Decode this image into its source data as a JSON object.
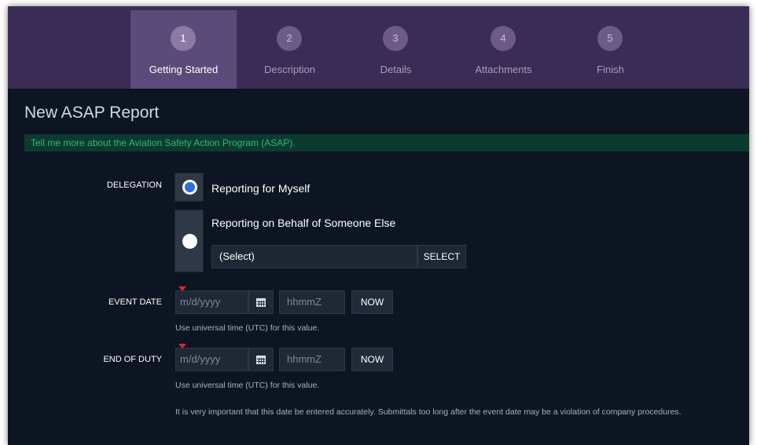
{
  "wizard": {
    "steps": [
      {
        "number": "1",
        "label": "Getting Started"
      },
      {
        "number": "2",
        "label": "Description"
      },
      {
        "number": "3",
        "label": "Details"
      },
      {
        "number": "4",
        "label": "Attachments"
      },
      {
        "number": "5",
        "label": "Finish"
      }
    ],
    "active_step": 1
  },
  "page": {
    "title": "New ASAP Report",
    "info_link": "Tell me more about the Aviation Safety Action Program (ASAP)."
  },
  "delegation": {
    "label": "DELEGATION",
    "option_self": "Reporting for Myself",
    "option_other": "Reporting on Behalf of Someone Else",
    "selected": "self",
    "select_value": "(Select)",
    "select_button": "SELECT"
  },
  "event_date": {
    "label": "EVENT DATE",
    "date_placeholder": "m/d/yyyy",
    "time_placeholder": "hhmmZ",
    "now_button": "NOW",
    "help": "Use universal time (UTC) for this value."
  },
  "end_of_duty": {
    "label": "END OF DUTY",
    "date_placeholder": "m/d/yyyy",
    "time_placeholder": "hhmmZ",
    "now_button": "NOW",
    "help": "Use universal time (UTC) for this value.",
    "warning": "It is very important that this date be entered accurately. Submittals too long after the event date may be a violation of company procedures."
  },
  "icons": {
    "calendar": "calendar-icon",
    "required": "required-marker"
  },
  "colors": {
    "header_bg": "#3a2d55",
    "active_step_bg": "#5b4b78",
    "page_bg": "#0c1521",
    "info_banner_bg": "#0d3a2e",
    "info_banner_text": "#30b97d",
    "radio_checked": "#2c6fdc",
    "required_marker": "#e02828"
  }
}
